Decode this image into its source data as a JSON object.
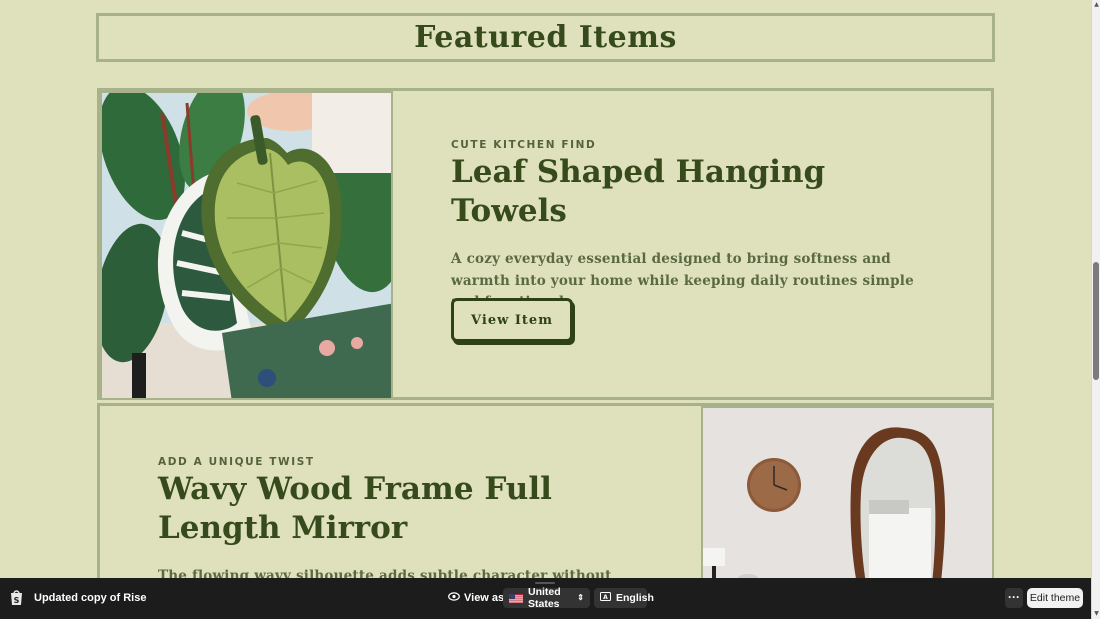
{
  "featured": {
    "heading": "Featured Items"
  },
  "items": [
    {
      "eyebrow": "CUTE KITCHEN FIND",
      "title": "Leaf Shaped Hanging Towels",
      "description": "A cozy everyday essential designed to bring softness and warmth into your home while keeping daily routines simple and functional.",
      "button_label": "View Item",
      "image_alt": "leaf-towels-photo"
    },
    {
      "eyebrow": "ADD A UNIQUE TWIST",
      "title": "Wavy Wood Frame Full Length Mirror",
      "description": "The flowing wavy silhouette adds subtle character without",
      "image_alt": "wavy-mirror-photo"
    }
  ],
  "bottom_bar": {
    "store_name": "Updated copy of Rise",
    "view_as_label": "View as",
    "country": "United States",
    "language": "English",
    "more_label": "···",
    "edit_theme_label": "Edit theme"
  },
  "colors": {
    "page_bg": "#dfe1bd",
    "heading_text": "#364a1c",
    "border": "#a8b28a",
    "bottom_bar_bg": "#1c1c1c"
  },
  "icons": [
    "shopify-bag-icon",
    "eye-icon",
    "us-flag-icon",
    "up-down-chevron-icon",
    "language-icon",
    "more-icon"
  ]
}
